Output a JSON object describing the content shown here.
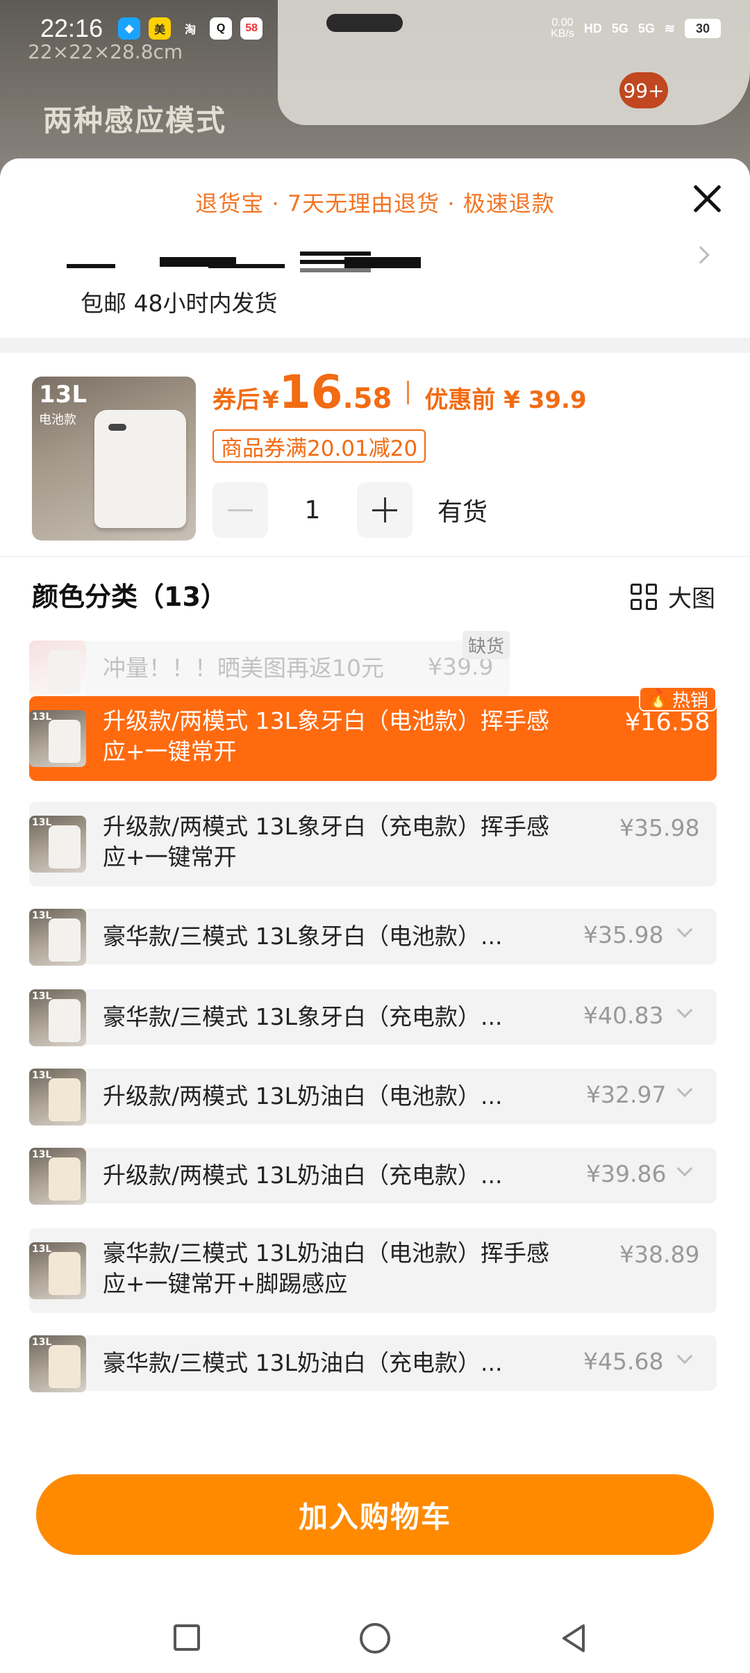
{
  "status_bar": {
    "time": "22:16",
    "net_speed": "0.00",
    "net_unit": "KB/s",
    "hd": "HD",
    "signal_1": "5G",
    "signal_2": "5G",
    "battery": "30"
  },
  "background": {
    "size_text": "22×22×28.8cm",
    "mode_text": "两种感应模式",
    "cart_badge": "99+"
  },
  "sheet": {
    "banner": "退货宝 · 7天无理由退货 · 极速退款",
    "shipping": "包邮 48小时内发货"
  },
  "product": {
    "thumb_label": "13L",
    "thumb_sub": "电池款",
    "after_coupon_label": "券后",
    "currency": "¥",
    "price_int": "16",
    "price_dec": ".58",
    "before_label": "优惠前 ¥ 39.9",
    "coupon": "商品券满20.01减20",
    "quantity": "1",
    "stock": "有货"
  },
  "section": {
    "title": "颜色分类（13）",
    "big_view": "大图"
  },
  "variants": [
    {
      "label": "冲量！！！晒美图再返10元",
      "price": "¥39.9",
      "tag": "缺货"
    },
    {
      "label": "升级款/两模式 13L象牙白（电池款）挥手感\n应+一键常开",
      "price": "¥16.58",
      "tag": "热销"
    },
    {
      "label": "升级款/两模式 13L象牙白（充电款）挥手感\n应+一键常开",
      "price": "¥35.98"
    },
    {
      "label": "豪华款/三模式 13L象牙白（电池款）...",
      "price": "¥35.98"
    },
    {
      "label": "豪华款/三模式 13L象牙白（充电款）...",
      "price": "¥40.83"
    },
    {
      "label": "升级款/两模式 13L奶油白（电池款）...",
      "price": "¥32.97"
    },
    {
      "label": "升级款/两模式 13L奶油白（充电款）...",
      "price": "¥39.86"
    },
    {
      "label": "豪华款/三模式 13L奶油白（电池款）挥手感\n应+一键常开+脚踢感应",
      "price": "¥38.89"
    },
    {
      "label": "豪华款/三模式 13L奶油白（充电款）...",
      "price": "¥45.68"
    }
  ],
  "cta": {
    "add_to_cart": "加入购物车"
  },
  "colors": {
    "accent": "#ff6a0e",
    "cta": "#ff8a00",
    "price": "#f26b12"
  }
}
